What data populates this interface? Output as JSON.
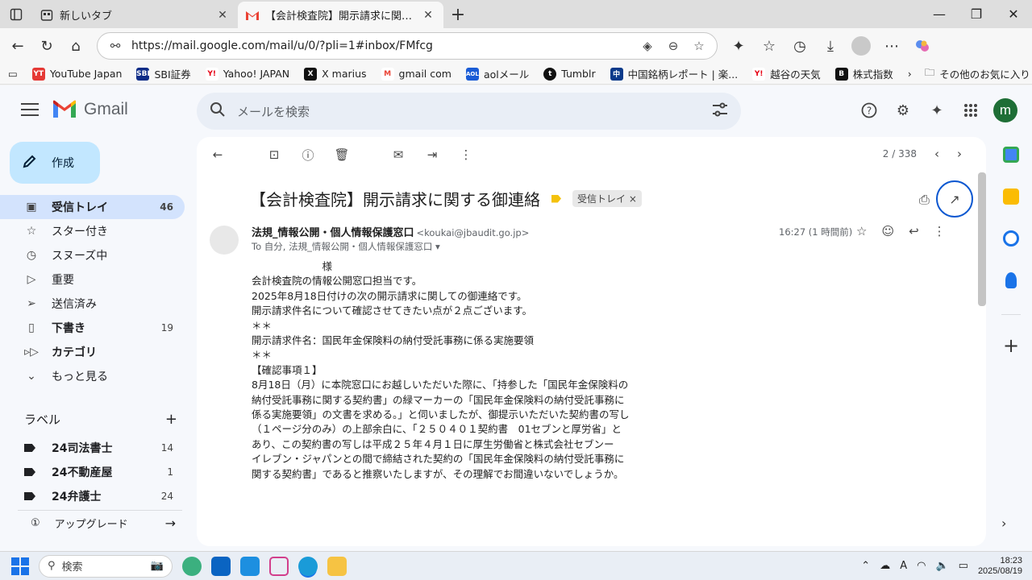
{
  "browser": {
    "tabs": [
      {
        "title": "新しいタブ",
        "active": false
      },
      {
        "title": "【会計検査院】開示請求に関する御連絡",
        "active": true
      }
    ],
    "url": "https://mail.google.com/mail/u/0/?pli=1#inbox/FMfcg",
    "bookmarks": [
      "YouTube Japan",
      "SBI証券",
      "Yahoo! JAPAN",
      "X marius",
      "gmail com",
      "aolメール",
      "Tumblr",
      "中国銘柄レポート | 楽...",
      "越谷の天気",
      "株式指数"
    ],
    "bookmark_favicons": [
      "YT",
      "SBI",
      "Y!",
      "X",
      "M",
      "AOL",
      "t",
      "中",
      "Y!",
      "B"
    ],
    "other_bookmarks": "その他のお気に入り"
  },
  "gmail": {
    "product_name": "Gmail",
    "search_placeholder": "メールを検索",
    "avatar_letter": "m",
    "compose_label": "作成",
    "nav": [
      {
        "label": "受信トレイ",
        "count": "46",
        "icon": "inbox-icon",
        "active": true
      },
      {
        "label": "スター付き",
        "count": "",
        "icon": "star-icon"
      },
      {
        "label": "スヌーズ中",
        "count": "",
        "icon": "clock-icon"
      },
      {
        "label": "重要",
        "count": "",
        "icon": "important-icon"
      },
      {
        "label": "送信済み",
        "count": "",
        "icon": "send-icon"
      },
      {
        "label": "下書き",
        "count": "19",
        "icon": "draft-icon",
        "bold": true
      },
      {
        "label": "カテゴリ",
        "count": "",
        "icon": "label-icon",
        "bold": true
      },
      {
        "label": "もっと見る",
        "count": "",
        "icon": "chevron-down-icon"
      }
    ],
    "labels_title": "ラベル",
    "labels": [
      {
        "label": "24司法書士",
        "count": "14"
      },
      {
        "label": "24不動産屋",
        "count": "1"
      },
      {
        "label": "24弁護士",
        "count": "24"
      }
    ],
    "upgrade_label": "アップグレード",
    "pager": "2 / 338",
    "message": {
      "subject": "【会計検査院】開示請求に関する御連絡",
      "label_chip": "受信トレイ",
      "sender_name": "法規_情報公開・個人情報保護窓口",
      "sender_email": "<koukai@jbaudit.go.jp>",
      "to": "To 自分, 法規_情報公開・個人情報保護窓口",
      "time": "16:27 (1 時間前)",
      "body": [
        "　　　　　　　様",
        "",
        "会計検査院の情報公開窓口担当です。",
        "2025年8月18日付けの次の開示請求に関しての御連絡です。",
        "開示請求件名について確認させてきたい点が２点ございます。",
        "",
        "＊＊",
        "開示請求件名：国民年金保険料の納付受託事務に係る実施要領",
        "＊＊",
        "",
        "【確認事項１】",
        "8月18日（月）に本院窓口にお越しいただいた際に、「持参した「国民年金保険料の",
        "納付受託事務に関する契約書」の緑マーカーの「国民年金保険料の納付受託事務に",
        "係る実施要領」の文書を求める。」と伺いましたが、御提示いただいた契約書の写し",
        "（１ページ分のみ）の上部余白に、「２５０４０１契約書　01セブンと厚労省」と",
        "あり、この契約書の写しは平成２５年４月１日に厚生労働省と株式会社セブンー",
        "イレブン・ジャパンとの間で締結された契約の「国民年金保険料の納付受託事務に",
        "関する契約書」であると推察いたしますが、その理解でお間違いないでしょうか。"
      ]
    }
  },
  "taskbar": {
    "search_label": "検索",
    "time": "18:23",
    "date": "2025/08/19",
    "ime": "A"
  }
}
